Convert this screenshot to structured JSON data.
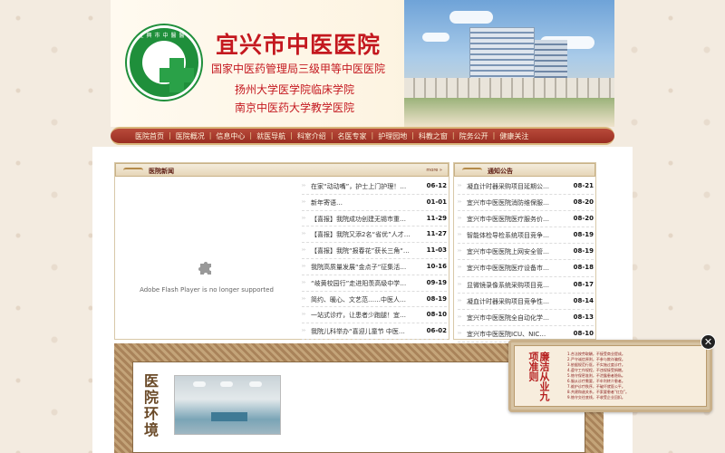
{
  "header": {
    "logo_text": "宜興市中醫醫院",
    "site_title": "宜兴市中医医院",
    "subtitles": [
      "国家中医药管理局三级甲等中医医院",
      "扬州大学医学院临床学院",
      "南京中医药大学教学医院"
    ]
  },
  "nav": {
    "items": [
      "医院首页",
      "医院概况",
      "信息中心",
      "就医导航",
      "科室介绍",
      "名医专家",
      "护理园地",
      "科教之窗",
      "院务公开",
      "健康关注"
    ]
  },
  "news": {
    "title": "医院新闻",
    "more": "more",
    "flash_message": "Adobe Flash Player is no longer supported",
    "items": [
      {
        "title": "在家“动动嘴”，护士上门护理！宜…",
        "date": "06-12"
      },
      {
        "title": "新年寄语…",
        "date": "01-01"
      },
      {
        "title": "【喜报】我院成功创建无锡市重点专…",
        "date": "11-29"
      },
      {
        "title": "【喜报】我院又添2名“省优”人才…",
        "date": "11-27"
      },
      {
        "title": "【喜报】我院“报春花”获长三角“…",
        "date": "11-03"
      },
      {
        "title": "我院高质量发展“金点子”征集活动…",
        "date": "10-16"
      },
      {
        "title": "“岐黄校园行”走进阳羡高级中学，…",
        "date": "09-19"
      },
      {
        "title": "简约、暖心、文艺范……中医人这样…",
        "date": "08-19"
      },
      {
        "title": "一站式诊疗，让患者少跑腿！宜兴市…",
        "date": "08-10"
      },
      {
        "title": "我院儿科举办“喜迎儿童节 中医护…",
        "date": "06-02"
      }
    ]
  },
  "notice": {
    "title": "通知公告",
    "items": [
      {
        "title": "凝血计时器采购项目延期公告…",
        "date": "08-21"
      },
      {
        "title": "宜兴市中医医院消防维保服务项…",
        "date": "08-20"
      },
      {
        "title": "宜兴市中医医院医疗服务价格调…",
        "date": "08-20"
      },
      {
        "title": "智能体检导检系统项目竞争性磋…",
        "date": "08-19"
      },
      {
        "title": "宜兴市中医医院上网安全管理设…",
        "date": "08-19"
      },
      {
        "title": "宜兴市中医医院医疗设备市场调…",
        "date": "08-18"
      },
      {
        "title": "显微镜录像系统采购项目竞争性…",
        "date": "08-17"
      },
      {
        "title": "凝血计时器采购项目竞争性磋商…",
        "date": "08-14"
      },
      {
        "title": "宜兴市中医医院全自动化学发光…",
        "date": "08-13"
      },
      {
        "title": "宜兴市中医医院ICU、NIC…",
        "date": "08-10"
      }
    ]
  },
  "environment": {
    "title": "医院环境"
  },
  "float_ad": {
    "heading": "廉洁从业九项准则",
    "close": "✕",
    "lines": [
      "1.合法按劳取酬，不接受商业提成。",
      "2.严守诚信原则，不参与欺诈骗保。",
      "3.依据规范行医，不实施过度诊疗。",
      "4.遵守工作规程，不违规接受捐赠。",
      "5.恪守保密准则，不泄露患者隐私。",
      "6.服从诊疗需要，不牟利转介患者。",
      "7.维护诊疗秩序，不破坏就医公平。",
      "8.共建和谐关系，不索要患者“红包”。",
      "9.恪守交往底线，不收受企业回扣。"
    ]
  }
}
